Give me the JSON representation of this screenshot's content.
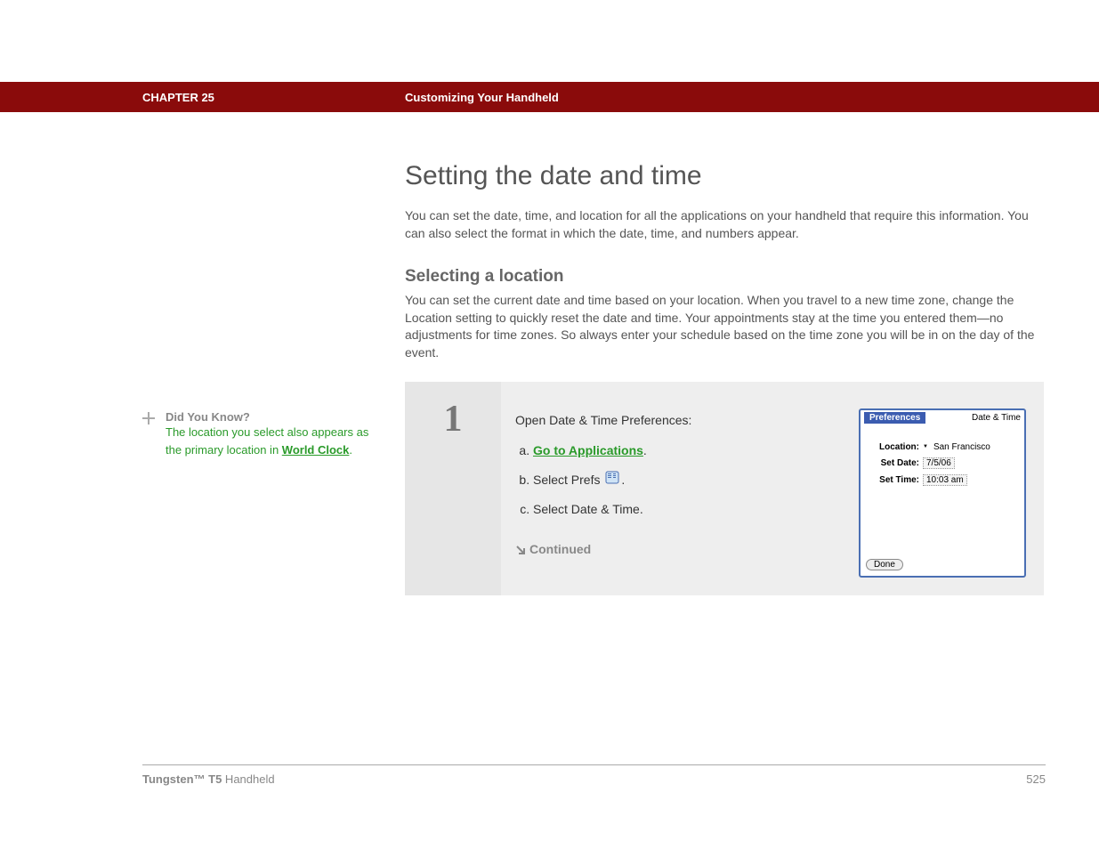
{
  "header": {
    "chapter_label": "CHAPTER 25",
    "chapter_title": "Customizing Your Handheld"
  },
  "sidebar": {
    "tip_title": "Did You Know?",
    "tip_body_prefix": "The location you select also appears as the primary location in ",
    "tip_link_text": "World Clock",
    "tip_body_suffix": "."
  },
  "main": {
    "h1": "Setting the date and time",
    "intro": "You can set the date, time, and location for all the applications on your handheld that require this information. You can also select the format in which the date, time, and numbers appear.",
    "h2": "Selecting a location",
    "sub_intro": "You can set the current date and time based on your location. When you travel to a new time zone, change the Location setting to quickly reset the date and time. Your appointments stay at the time you entered them—no adjustments for time zones. So always enter your schedule based on the time zone you will be in on the day of the event.",
    "step": {
      "number": "1",
      "lead": "Open Date & Time Preferences:",
      "item_a_link": "Go to Applications",
      "item_a_suffix": ".",
      "item_b_prefix": "Select Prefs ",
      "item_b_suffix": ".",
      "item_c": "Select Date & Time.",
      "continued": "Continued"
    },
    "palm": {
      "title_left": "Preferences",
      "title_right": "Date & Time",
      "location_label": "Location:",
      "location_value": "San Francisco",
      "date_label": "Set Date:",
      "date_value": "7/5/06",
      "time_label": "Set Time:",
      "time_value": "10:03 am",
      "done": "Done"
    }
  },
  "footer": {
    "product_bold": "Tungsten™ T5",
    "product_light": " Handheld",
    "page": "525"
  }
}
